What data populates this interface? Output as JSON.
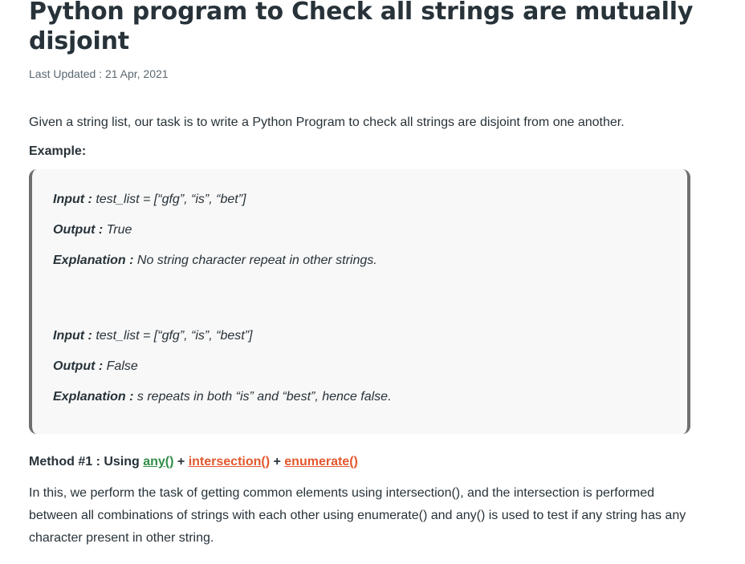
{
  "article": {
    "title": "Python program to Check all strings are mutually disjoint",
    "last_updated": "Last Updated : 21 Apr, 2021",
    "intro": "Given a string list, our task is to write a Python Program to check all strings are disjoint from one another.",
    "example_label": "Example:"
  },
  "examples": [
    {
      "input_label": "Input :",
      "input_value": " test_list = [“gfg”, “is”, “bet”]",
      "output_label": "Output :",
      "output_value": " True",
      "explanation_label": "Explanation :",
      "explanation_value": " No string character repeat in other strings."
    },
    {
      "input_label": "Input :",
      "input_value": " test_list = [“gfg”, “is”, “best”]",
      "output_label": "Output :",
      "output_value": " False",
      "explanation_label": "Explanation :",
      "explanation_value": " s repeats in both “is” and “best”, hence false."
    }
  ],
  "method": {
    "prefix": "Method #1 : Using ",
    "link1": "any()",
    "sep1": " + ",
    "link2": "intersection()",
    "sep2": " + ",
    "link3": "enumerate()",
    "link1_color": "#2f8d46",
    "link2_color": "#e4572e",
    "link3_color": "#e4572e"
  },
  "paragraph": "In this, we perform the task of getting common elements using intersection(), and the intersection is performed between all combinations of strings with each other using enumerate() and any() is used to test if any string has any character present in other string."
}
